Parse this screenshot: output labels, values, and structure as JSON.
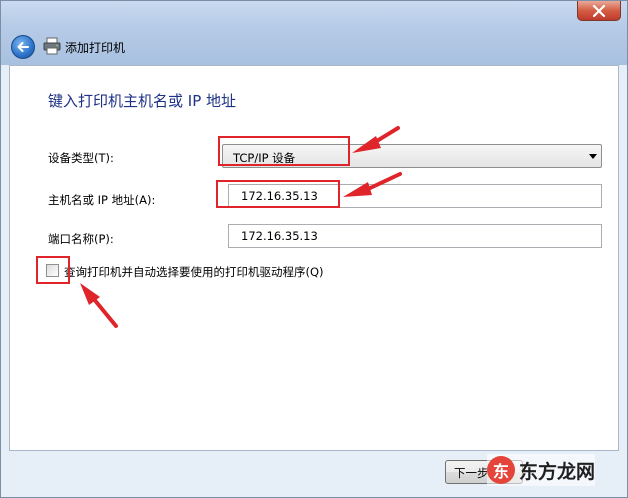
{
  "window": {
    "title": "添加打印机"
  },
  "main": {
    "heading": "键入打印机主机名或 IP 地址",
    "device_type": {
      "label": "设备类型(T):",
      "value": "TCP/IP 设备"
    },
    "hostname": {
      "label": "主机名或 IP 地址(A):",
      "value": "172.16.35.13"
    },
    "port": {
      "label": "端口名称(P):",
      "value": "172.16.35.13"
    },
    "auto_driver": {
      "label": "查询打印机并自动选择要使用的打印机驱动程序(Q)",
      "checked": false
    }
  },
  "footer": {
    "next_label": "下一步(N)"
  },
  "watermark": {
    "logo_char": "东",
    "text": "东方龙网"
  },
  "colors": {
    "annotation_red": "#e0252a",
    "heading_blue": "#1e3287"
  }
}
